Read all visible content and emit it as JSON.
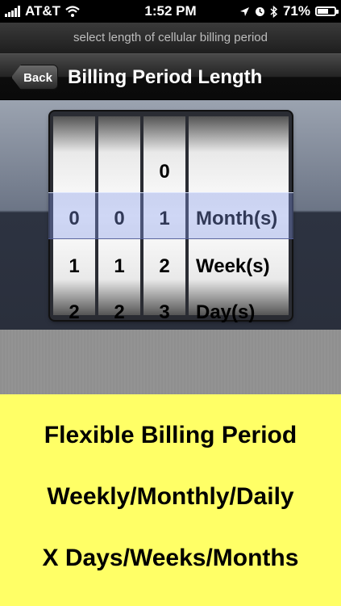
{
  "status_bar": {
    "carrier": "AT&T",
    "time": "1:52 PM",
    "battery_percent": "71%",
    "battery_level": 0.71,
    "icons": [
      "signal-icon",
      "wifi-icon",
      "location-icon",
      "alarm-icon",
      "bluetooth-icon",
      "battery-icon"
    ]
  },
  "prompt": "select length of cellular billing period",
  "nav": {
    "back_label": "Back",
    "title": "Billing Period Length"
  },
  "picker": {
    "columns": [
      {
        "items": [
          "",
          "0",
          "1",
          "2"
        ],
        "selected": "0"
      },
      {
        "items": [
          "",
          "0",
          "1",
          "2"
        ],
        "selected": "0"
      },
      {
        "items": [
          "0",
          "1",
          "2",
          "3"
        ],
        "selected": "1"
      },
      {
        "items": [
          "",
          "Month(s)",
          "Week(s)",
          "Day(s)"
        ],
        "selected": "Month(s)"
      }
    ]
  },
  "promo": {
    "line1": "Flexible Billing Period",
    "line2": "Weekly/Monthly/Daily",
    "line3": "X Days/Weeks/Months"
  },
  "colors": {
    "promo_background": "#ffff66",
    "selection_highlight": "#8296e6"
  }
}
